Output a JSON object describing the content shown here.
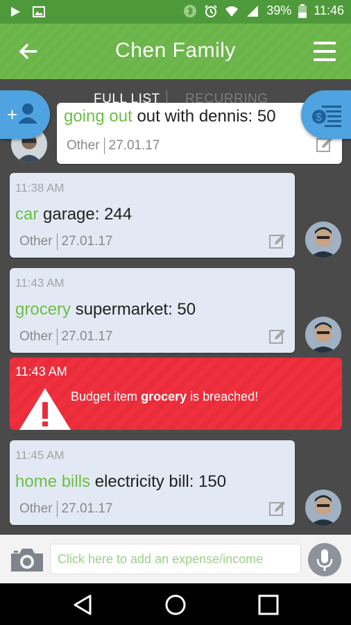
{
  "status": {
    "battery": "39%",
    "time": "11:46"
  },
  "header": {
    "title": "Chen Family"
  },
  "tabs": [
    {
      "label": "FULL LIST"
    },
    {
      "label": "RECURRING"
    }
  ],
  "messages": [
    {
      "category": "going out",
      "text": "out with dennis: 50",
      "meta_type": "Other",
      "meta_date": "27.01.17"
    },
    {
      "time": "11:38 AM",
      "category": "car",
      "text": "garage: 244",
      "meta_type": "Other",
      "meta_date": "27.01.17"
    },
    {
      "time": "11:43 AM",
      "category": "grocery",
      "text": "supermarket: 50",
      "meta_type": "Other",
      "meta_date": "27.01.17"
    },
    {
      "time": "11:45 AM",
      "category": "home bills",
      "text": "electricity bill: 150",
      "meta_type": "Other",
      "meta_date": "27.01.17"
    }
  ],
  "alert": {
    "time": "11:43 AM",
    "prefix": "Budget item",
    "item": "grocery",
    "suffix": "is breached!"
  },
  "input": {
    "placeholder": "Click here to add an expense/income"
  },
  "colors": {
    "green": "#6ab449",
    "blue": "#4fa3e0",
    "red": "#f0303e",
    "category": "#6cbe45"
  }
}
